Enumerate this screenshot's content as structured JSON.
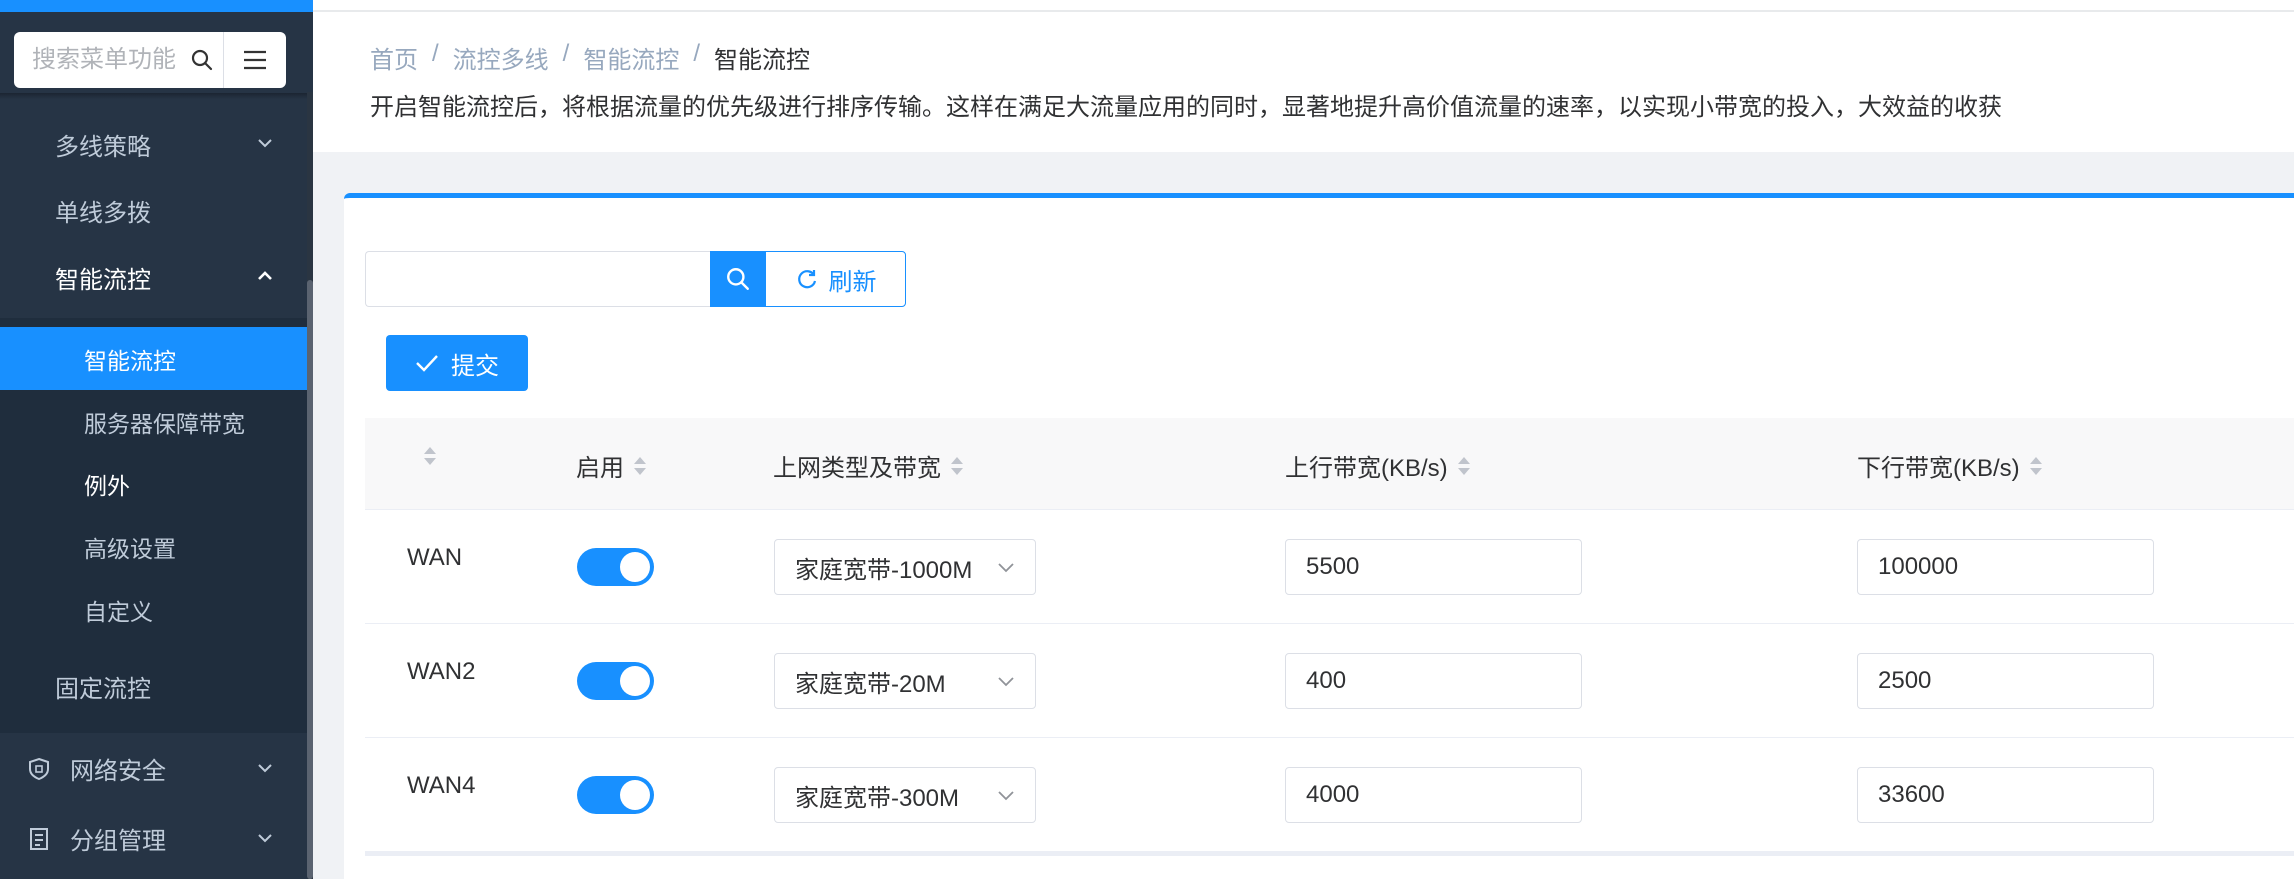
{
  "sidebar": {
    "search_placeholder": "搜索菜单功能",
    "items": [
      {
        "label": "多线策略"
      },
      {
        "label": "单线多拨"
      },
      {
        "label": "智能流控"
      }
    ],
    "sub_items": [
      {
        "label": "智能流控"
      },
      {
        "label": "服务器保障带宽"
      },
      {
        "label": "例外"
      },
      {
        "label": "高级设置"
      },
      {
        "label": "自定义"
      }
    ],
    "fixed_flow": "固定流控",
    "groups": [
      {
        "label": "网络安全"
      },
      {
        "label": "分组管理"
      }
    ]
  },
  "header": {
    "breadcrumb": [
      "首页",
      "流控多线",
      "智能流控",
      "智能流控"
    ],
    "separator": "/",
    "description": "开启智能流控后，将根据流量的优先级进行排序传输。这样在满足大流量应用的同时，显著地提升高价值流量的速率，以实现小带宽的投入，大效益的收获"
  },
  "toolbar": {
    "search_value": "",
    "refresh_label": "刷新",
    "submit_label": "提交"
  },
  "table": {
    "headers": {
      "enable": "启用",
      "type": "上网类型及带宽",
      "up": "上行带宽(KB/s)",
      "down": "下行带宽(KB/s)"
    },
    "rows": [
      {
        "name": "WAN",
        "enabled": true,
        "type": "家庭宽带-1000M",
        "up": "5500",
        "down": "100000"
      },
      {
        "name": "WAN2",
        "enabled": true,
        "type": "家庭宽带-20M",
        "up": "400",
        "down": "2500"
      },
      {
        "name": "WAN4",
        "enabled": true,
        "type": "家庭宽带-300M",
        "up": "4000",
        "down": "33600"
      }
    ]
  },
  "colors": {
    "primary": "#1890ff",
    "sidebar": "#263445",
    "submenu": "#1f2d3d"
  }
}
